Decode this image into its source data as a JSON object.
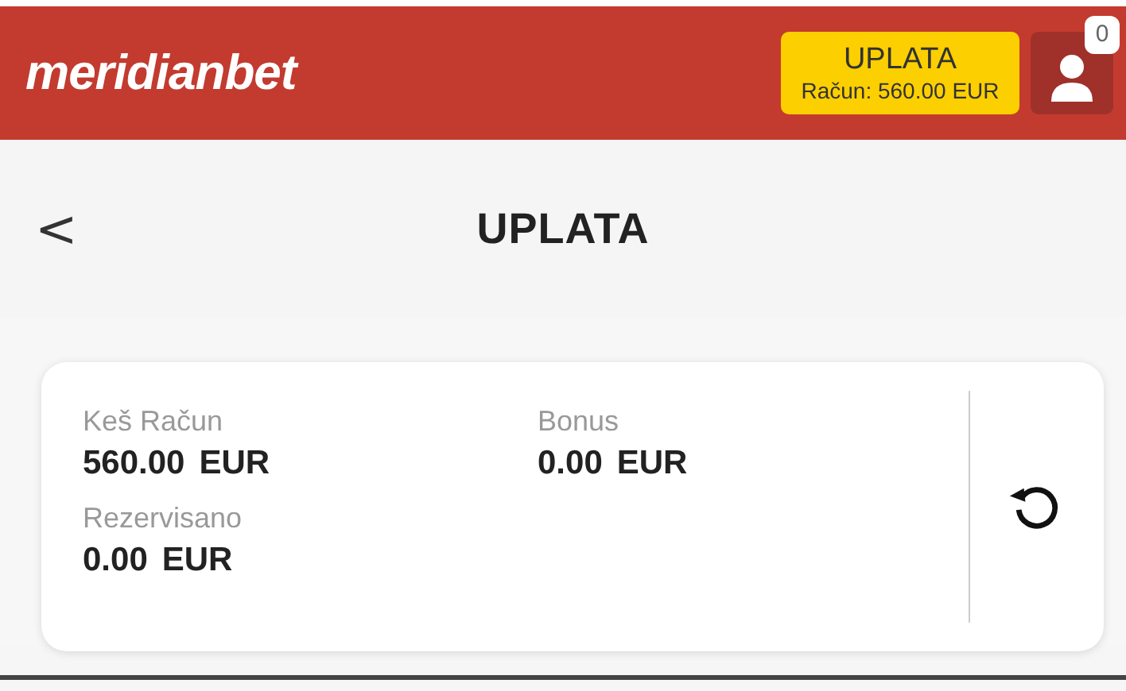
{
  "header": {
    "logo": "meridianbet",
    "deposit_button": {
      "title": "UPLATA",
      "balance": "Račun: 560.00 EUR"
    },
    "notifications": {
      "count": "0"
    }
  },
  "page": {
    "title": "UPLATA",
    "back": "<"
  },
  "balances": [
    {
      "label": "Keš Račun",
      "amount": "560.00",
      "currency": "EUR"
    },
    {
      "label": "Bonus",
      "amount": "0.00",
      "currency": "EUR"
    },
    {
      "label": "Rezervisano",
      "amount": "0.00",
      "currency": "EUR"
    }
  ]
}
